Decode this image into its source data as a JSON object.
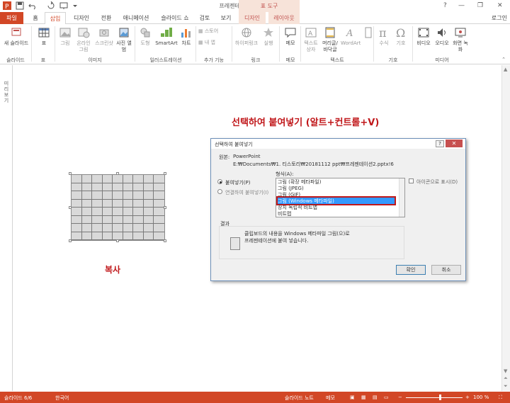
{
  "app": {
    "title": "프레젠테이션2 - PowerPoint",
    "tool_context": "표 도구",
    "window_buttons": [
      "?",
      "—",
      "❐",
      "✕"
    ],
    "user": "로그인"
  },
  "tabs": [
    {
      "label": "파일"
    },
    {
      "label": "홈"
    },
    {
      "label": "삽입"
    },
    {
      "label": "디자인"
    },
    {
      "label": "전환"
    },
    {
      "label": "애니메이션"
    },
    {
      "label": "슬라이드 쇼"
    },
    {
      "label": "검토"
    },
    {
      "label": "보기"
    },
    {
      "label": "디자인"
    },
    {
      "label": "레이아웃"
    }
  ],
  "ribbon": {
    "buttons": {
      "new_slide": "새 슬라이드",
      "table": "표",
      "picture": "그림",
      "online_picture": "온라인 그림",
      "screenshot": "스크린샷",
      "photo_album": "사진 앨범",
      "shapes": "도형",
      "smartart": "SmartArt",
      "chart": "차트",
      "store": "스토어",
      "my_apps": "내 앱",
      "hyperlink": "하이퍼링크",
      "action": "실행",
      "comment": "메모",
      "textbox": "텍스트 상자",
      "header_footer": "머리글/ 바닥글",
      "wordart": "WordArt",
      "equation": "수식",
      "symbol": "기호",
      "video": "비디오",
      "audio": "오디오",
      "screen_recording": "화면 녹화"
    },
    "groups": {
      "slides": "슬라이드",
      "tables": "표",
      "images": "이미지",
      "illustrations": "일러스트레이션",
      "apps": "추가 기능",
      "links": "링크",
      "comments": "메모",
      "text": "텍스트",
      "symbols": "기호",
      "media": "미디어"
    }
  },
  "left_pane": {
    "label": "미리 보기"
  },
  "slide": {
    "heading": "선택하여 붙여넣기 (알트+컨트롤+V)",
    "copy_label": "복사"
  },
  "dialog": {
    "title": "선택하여 붙여넣기",
    "help": "?",
    "close": "✕",
    "source_label": "원본:",
    "source_app": "PowerPoint",
    "source_path": "E:₩Documents₩1. 티스토리₩20181112 ppt₩프레젠테이션2.pptx!6",
    "format_label": "형식(A):",
    "paste_option": "붙여넣기(P)",
    "paste_link_option": "연결하여 붙여넣기(I)",
    "format_items": [
      "그림 (확장 메타파일)",
      "그림 (JPEG)",
      "그림 (GIF)",
      "그림 (Windows 메타파일)",
      "장치 독립적 비트맵",
      "비트맵"
    ],
    "selected_format": "그림 (Windows 메타파일)",
    "display_as_icon": "아이콘으로 표시(D)",
    "result_label": "결과",
    "result_text_1": "클립보드의 내용을 Windows 메타파일 그림(으)로",
    "result_text_2": "프레젠테이션에 붙여 넣습니다.",
    "ok": "확인",
    "cancel": "취소"
  },
  "statusbar": {
    "slide_count": "슬라이드 6/6",
    "language": "한국어",
    "notes": "슬라이드 노트",
    "comments": "메모",
    "zoom": "100 %"
  },
  "colors": {
    "accent": "#d24726",
    "heading_red": "#c0171a",
    "selection_blue": "#3399ff"
  }
}
